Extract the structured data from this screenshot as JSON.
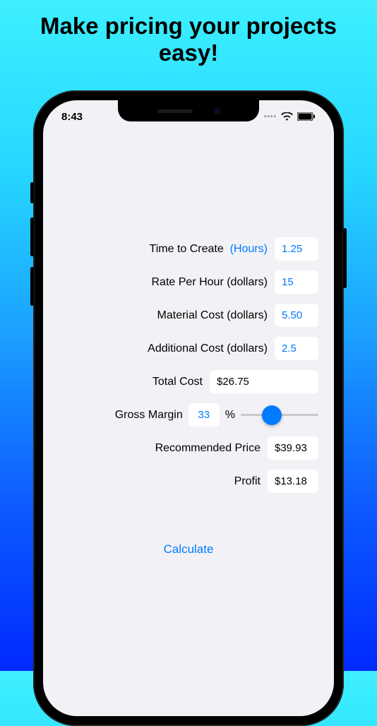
{
  "marketing": {
    "headline": "Make pricing your projects easy!"
  },
  "status": {
    "time": "8:43"
  },
  "form": {
    "time_to_create": {
      "label": "Time to Create",
      "unit_label": "(Hours)",
      "value": "1.25"
    },
    "rate_per_hour": {
      "label": "Rate Per Hour (dollars)",
      "value": "15"
    },
    "material_cost": {
      "label": "Material Cost (dollars)",
      "value": "5.50"
    },
    "additional_cost": {
      "label": "Additional Cost (dollars)",
      "value": "2.5"
    },
    "total_cost": {
      "label": "Total Cost",
      "value": "$26.75"
    },
    "gross_margin": {
      "label": "Gross Margin",
      "value": "33",
      "pct_symbol": "%",
      "slider_pos_pct": 40
    },
    "recommended_price": {
      "label": "Recommended Price",
      "value": "$39.93"
    },
    "profit": {
      "label": "Profit",
      "value": "$13.18"
    }
  },
  "actions": {
    "calculate": "Calculate"
  }
}
